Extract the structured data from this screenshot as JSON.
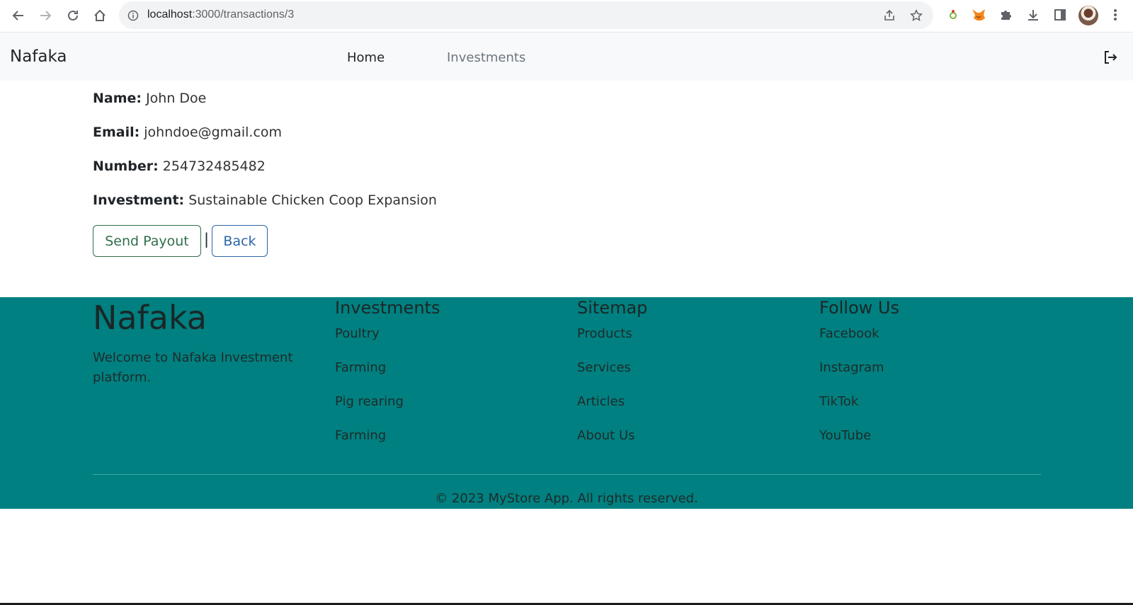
{
  "browser": {
    "url_host": "localhost",
    "url_path": ":3000/transactions/3"
  },
  "navbar": {
    "brand": "Nafaka",
    "links": [
      {
        "label": "Home"
      },
      {
        "label": "Investments"
      }
    ]
  },
  "details": {
    "name_label": "Name:",
    "name_value": "John Doe",
    "email_label": "Email:",
    "email_value": "johndoe@gmail.com",
    "number_label": "Number:",
    "number_value": "254732485482",
    "investment_label": "Investment:",
    "investment_value": "Sustainable Chicken Coop Expansion"
  },
  "actions": {
    "send_payout": "Send Payout",
    "separator": "|",
    "back": "Back"
  },
  "footer": {
    "brand": "Nafaka",
    "welcome": "Welcome to Nafaka Investment platform.",
    "columns": [
      {
        "title": "Investments",
        "links": [
          "Poultry",
          "Farming",
          "Pig rearing",
          "Farming"
        ]
      },
      {
        "title": "Sitemap",
        "links": [
          "Products",
          "Services",
          "Articles",
          "About Us"
        ]
      },
      {
        "title": "Follow Us",
        "links": [
          "Facebook",
          "Instagram",
          "TikTok",
          "YouTube"
        ]
      }
    ],
    "copyright": "© 2023 MyStore App. All rights reserved."
  },
  "colors": {
    "footer_bg": "#008080",
    "navbar_bg": "#f8f9fa",
    "payout_border": "#2f6f4b",
    "back_border": "#2c64a8"
  }
}
